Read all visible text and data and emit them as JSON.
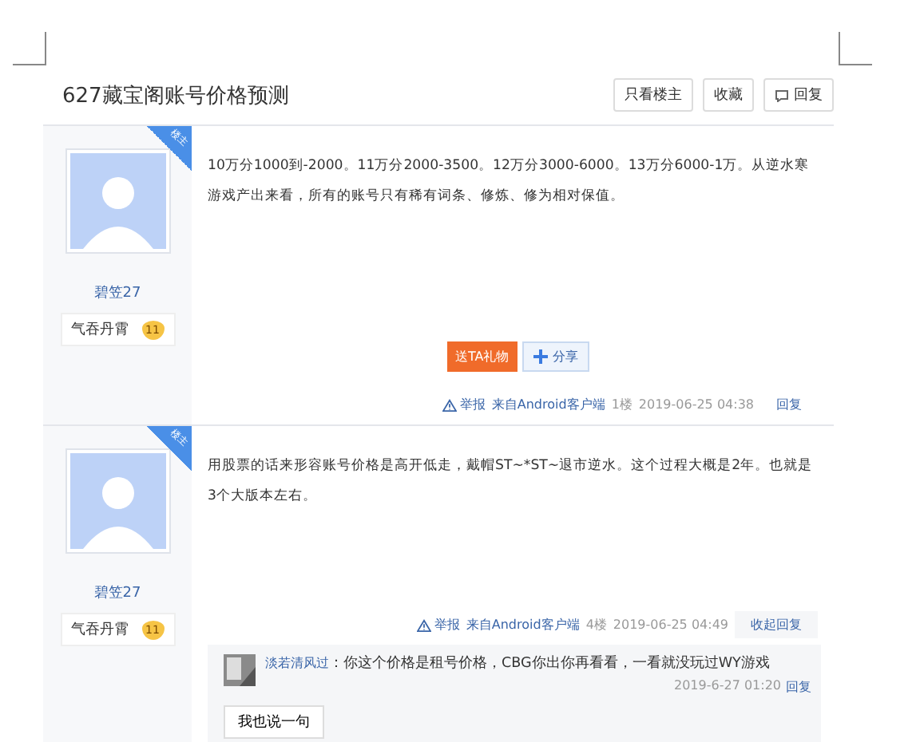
{
  "thread": {
    "title": "627藏宝阁账号价格预测",
    "actions": [
      {
        "label": "只看楼主",
        "kind": "text"
      },
      {
        "label": "收藏",
        "kind": "text"
      },
      {
        "label": "回复",
        "kind": "reply"
      }
    ]
  },
  "posts": [
    {
      "author": "碧笠27",
      "badge": "楼主",
      "rank": "气吞丹霄",
      "level": "11",
      "text": "10万分1000到-2000。11万分2000-3500。12万分3000-6000。13万分6000-1万。从逆水寒游戏产出来看，所有的账号只有稀有词条、修炼、修为相对保值。",
      "gift": "送TA礼物",
      "share": "分享",
      "report": "举报",
      "source": "来自Android客户端",
      "floor": "1楼",
      "time": "2019-06-25 04:38",
      "reply": "回复"
    },
    {
      "author": "碧笠27",
      "badge": "楼主",
      "rank": "气吞丹霄",
      "level": "11",
      "text": "用股票的话来形容账号价格是高开低走，戴帽ST~*ST~退市逆水。这个过程大概是2年。也就是3个大版本左右。",
      "report": "举报",
      "source": "来自Android客户端",
      "floor": "4楼",
      "time": "2019-06-25 04:49",
      "reply": "收起回复",
      "comments": [
        {
          "user": "淡若清风过",
          "text": "：你这个价格是租号价格，CBG你出你再看看，一看就没玩过WY游戏",
          "time": "2019-6-27 01:20",
          "reply": "回复"
        }
      ],
      "say": "我也说一句"
    }
  ]
}
